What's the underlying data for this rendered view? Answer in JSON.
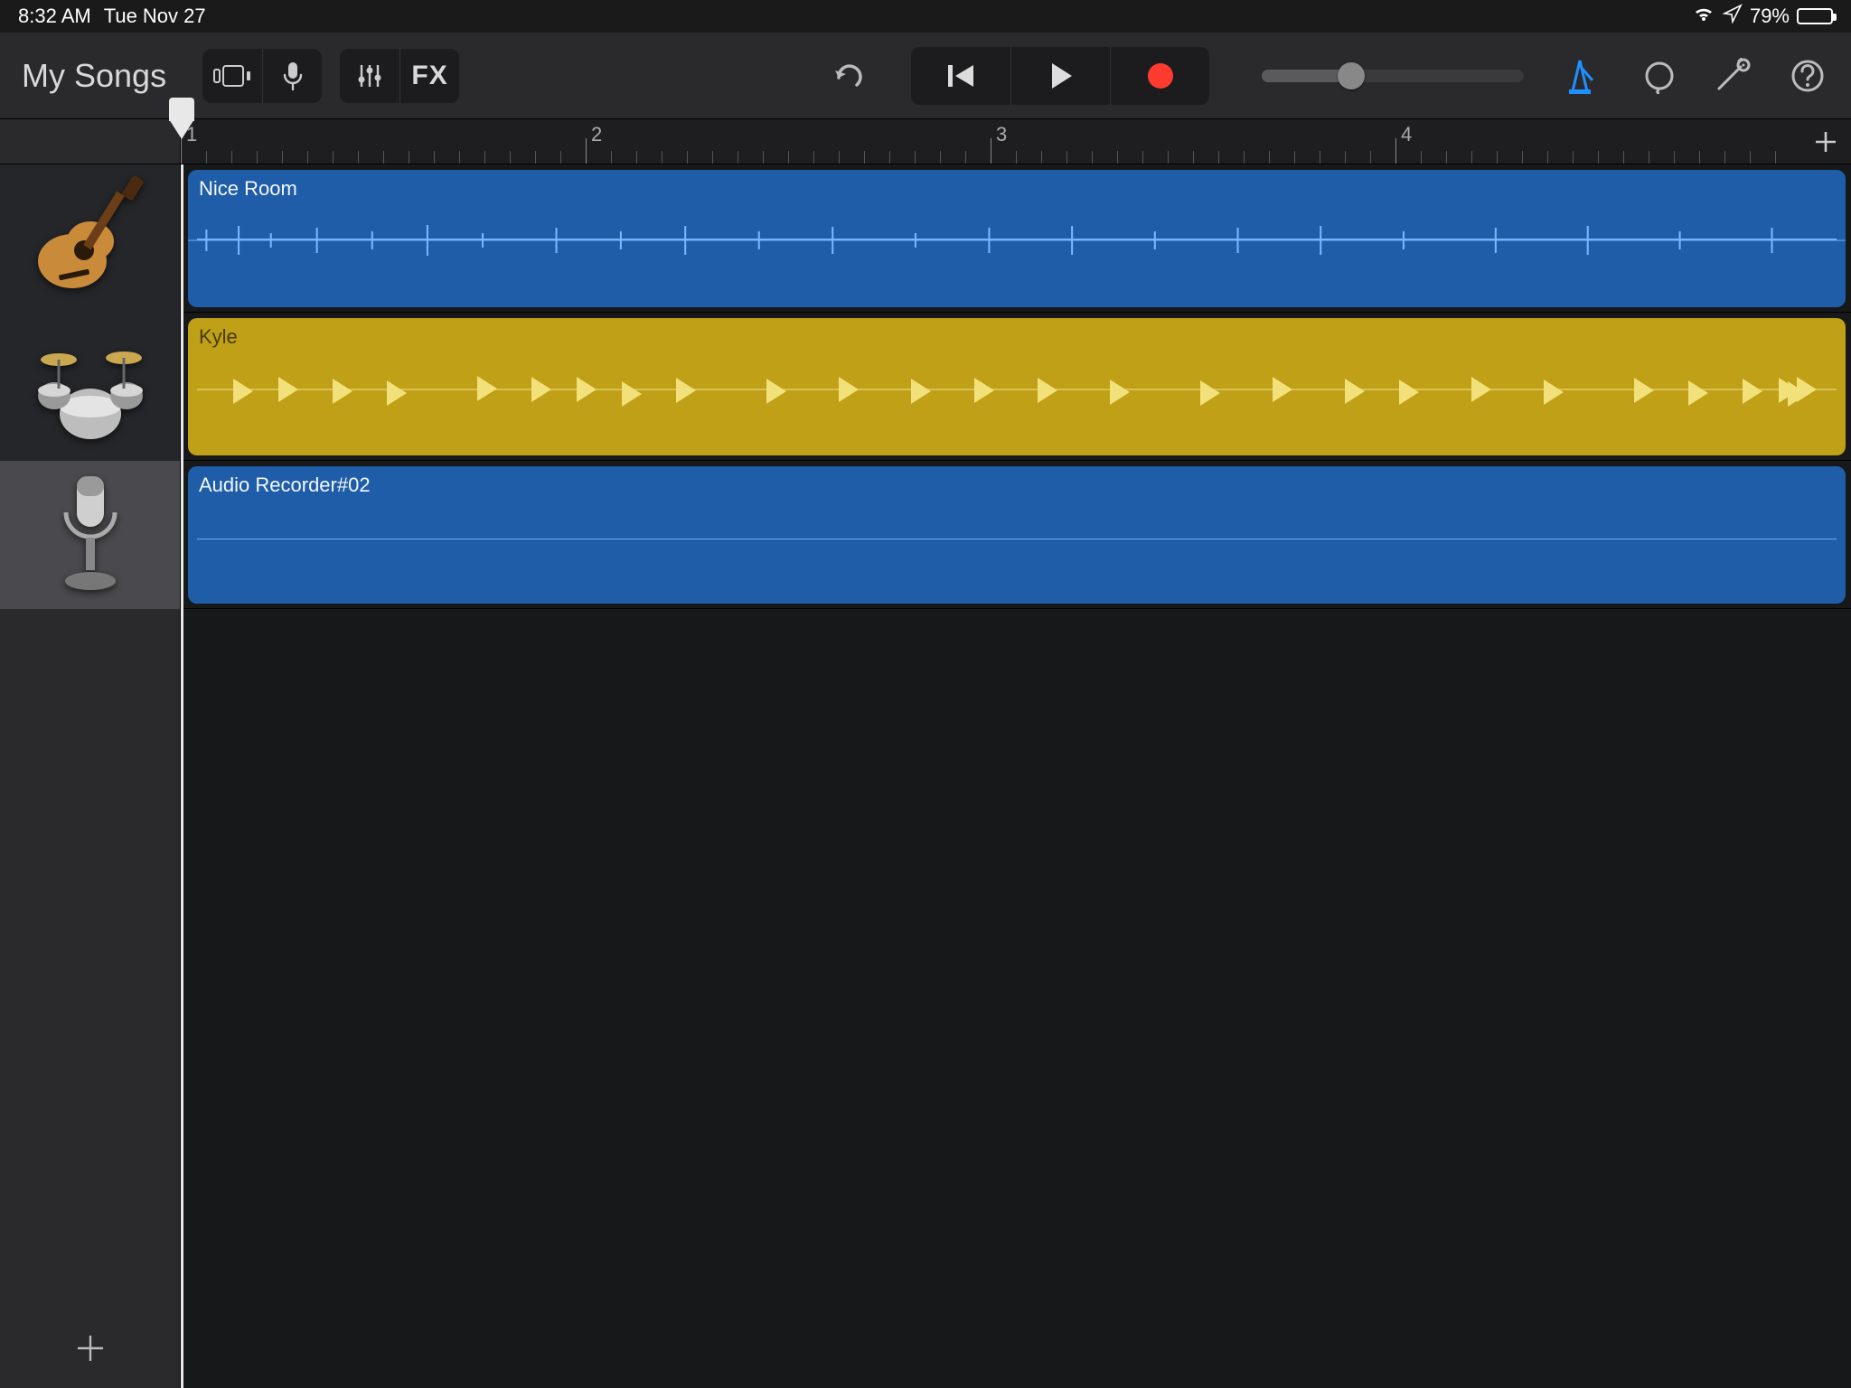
{
  "status": {
    "time": "8:32 AM",
    "date": "Tue Nov 27",
    "battery_pct": "79%"
  },
  "toolbar": {
    "back_label": "My Songs",
    "fx_label": "FX"
  },
  "ruler": {
    "bars": [
      "1",
      "2",
      "3",
      "4"
    ]
  },
  "tracks": [
    {
      "instrument": "guitar",
      "region_label": "Nice Room",
      "color": "blue",
      "type": "audio"
    },
    {
      "instrument": "drums",
      "region_label": "Kyle",
      "color": "yellow",
      "type": "midi"
    },
    {
      "instrument": "mic",
      "region_label": "Audio Recorder#02",
      "color": "blue",
      "type": "audio",
      "selected": true
    }
  ]
}
